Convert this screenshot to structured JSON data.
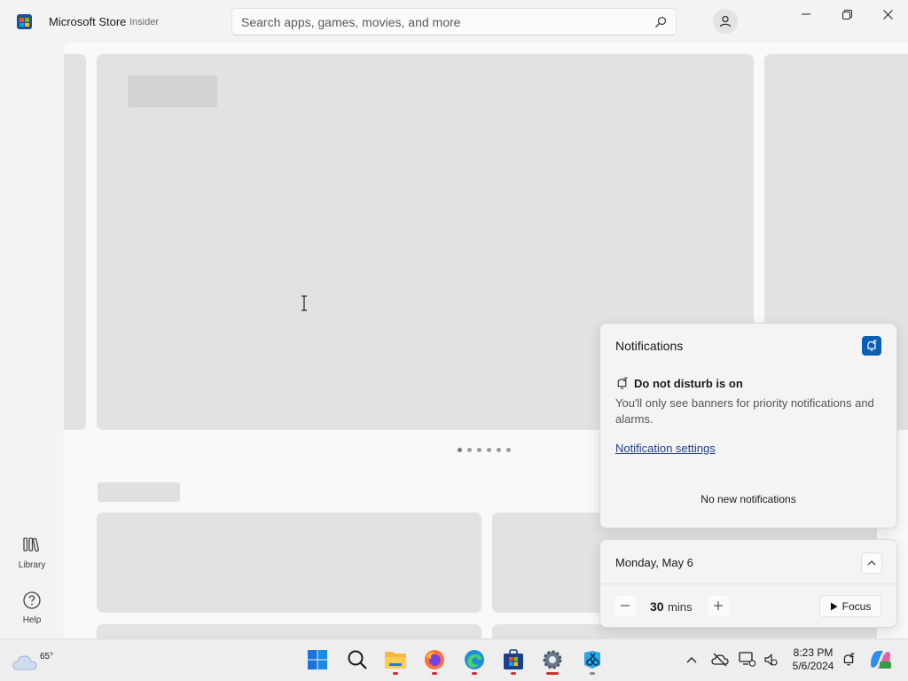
{
  "titlebar": {
    "app_name": "Microsoft Store",
    "badge": "Insider",
    "search_placeholder": "Search apps, games, movies, and more"
  },
  "nav": {
    "library_label": "Library",
    "help_label": "Help"
  },
  "notifications": {
    "title": "Notifications",
    "dnd_heading": "Do not disturb is on",
    "dnd_description": "You'll only see banners for priority notifications and alarms.",
    "settings_link": "Notification settings",
    "empty_message": "No new notifications"
  },
  "calendar": {
    "date": "Monday, May 6",
    "focus_minutes": "30",
    "focus_unit": "mins",
    "focus_button": "Focus"
  },
  "taskbar": {
    "weather_temp": "65°",
    "time": "8:23 PM",
    "date": "5/6/2024",
    "apps": [
      "windows-start",
      "search",
      "file-explorer",
      "firefox",
      "edge",
      "microsoft-store",
      "settings",
      "snipping-tool"
    ]
  },
  "colors": {
    "accent": "#0a5fb4",
    "link": "#1f3f86",
    "running_indicator": "#d32f2f",
    "placeholder": "#e2e2e2"
  }
}
